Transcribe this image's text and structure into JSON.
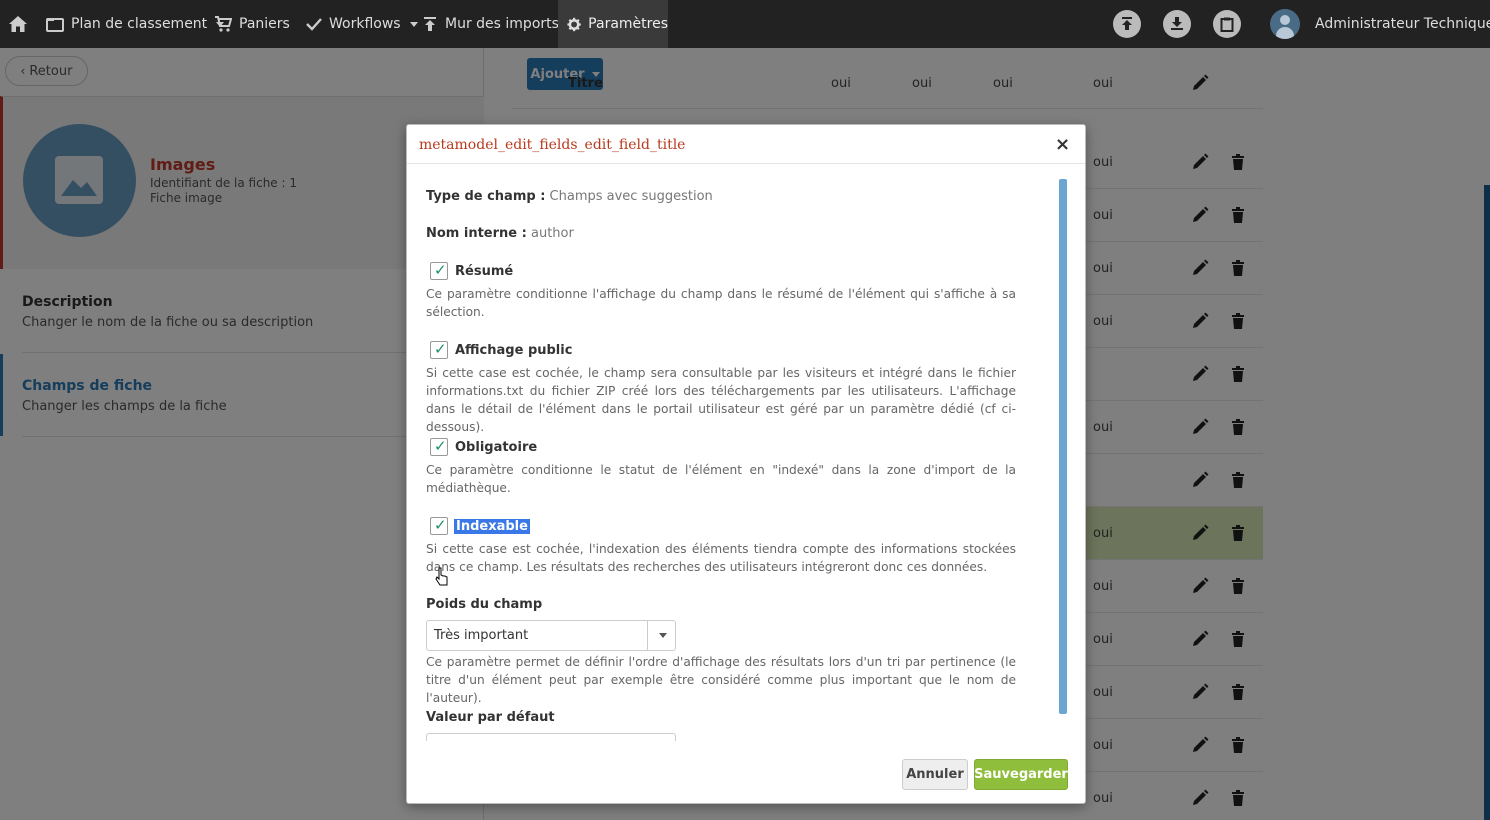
{
  "nav": {
    "home_icon": "home-icon",
    "items": [
      {
        "label": "Plan de classement",
        "icon": "folder-icon",
        "dropdown": true
      },
      {
        "label": "Paniers",
        "icon": "cart-icon",
        "dropdown": false
      },
      {
        "label": "Workflows",
        "icon": "check-icon",
        "dropdown": true
      },
      {
        "label": "Mur des imports",
        "icon": "upload-icon",
        "dropdown": false
      },
      {
        "label": "Paramètres",
        "icon": "gear-icon",
        "dropdown": false
      }
    ],
    "user": "Administrateur Technique"
  },
  "left": {
    "back_label": "Retour",
    "fiche": {
      "title": "Images",
      "identifier": "Identifiant de la fiche : 1",
      "type": "Fiche image"
    },
    "menu": [
      {
        "title": "Description",
        "subtitle": "Changer le nom de la fiche ou sa description"
      },
      {
        "title": "Champs de fiche",
        "subtitle": "Changer les champs de la fiche"
      }
    ]
  },
  "table": {
    "add_label": "Ajouter",
    "rows": [
      {
        "name": "Titre",
        "c1": "oui",
        "c2": "oui",
        "c3": "oui",
        "c4": "oui",
        "deletable": false
      },
      {
        "name": "",
        "c1": "",
        "c2": "",
        "c3": "",
        "c4": "oui",
        "deletable": true
      },
      {
        "name": "",
        "c1": "",
        "c2": "",
        "c3": "",
        "c4": "oui",
        "deletable": true
      },
      {
        "name": "",
        "c1": "",
        "c2": "",
        "c3": "",
        "c4": "oui",
        "deletable": true
      },
      {
        "name": "",
        "c1": "",
        "c2": "",
        "c3": "",
        "c4": "oui",
        "deletable": true
      },
      {
        "name": "",
        "c1": "",
        "c2": "",
        "c3": "",
        "c4": "",
        "deletable": true
      },
      {
        "name": "",
        "c1": "",
        "c2": "",
        "c3": "",
        "c4": "oui",
        "deletable": true
      },
      {
        "name": "",
        "c1": "",
        "c2": "",
        "c3": "",
        "c4": "",
        "deletable": true
      },
      {
        "name": "",
        "c1": "",
        "c2": "",
        "c3": "",
        "c4": "oui",
        "deletable": true
      },
      {
        "name": "",
        "c1": "",
        "c2": "",
        "c3": "",
        "c4": "oui",
        "deletable": true
      },
      {
        "name": "",
        "c1": "",
        "c2": "",
        "c3": "",
        "c4": "oui",
        "deletable": true
      },
      {
        "name": "",
        "c1": "",
        "c2": "",
        "c3": "",
        "c4": "oui",
        "deletable": true
      },
      {
        "name": "",
        "c1": "",
        "c2": "",
        "c3": "",
        "c4": "oui",
        "deletable": true
      },
      {
        "name": "",
        "c1": "",
        "c2": "",
        "c3": "",
        "c4": "oui",
        "deletable": true
      }
    ]
  },
  "modal": {
    "title": "metamodel_edit_fields_edit_field_title",
    "type_label": "Type de champ :",
    "type_value": "Champs avec suggestion",
    "internal_label": "Nom interne :",
    "internal_value": "author",
    "options": [
      {
        "label": "Résumé",
        "checked": true,
        "help": "Ce paramètre conditionne l'affichage du champ dans le résumé de l'élément qui s'affiche à sa sélection."
      },
      {
        "label": "Affichage public",
        "checked": true,
        "help": "Si cette case est cochée, le champ sera consultable par les visiteurs et intégré dans le fichier informations.txt du fichier ZIP créé lors des téléchargements par les utilisateurs. L'affichage dans le détail de l'élément dans le portail utilisateur est géré par un paramètre dédié (cf ci-dessous)."
      },
      {
        "label": "Obligatoire",
        "checked": true,
        "help": "Ce paramètre conditionne le statut de l'élément en \"indexé\" dans la zone d'import de la médiathèque."
      },
      {
        "label": "Indexable",
        "checked": true,
        "help": "Si cette case est cochée, l'indexation des éléments tiendra compte des informations stockées dans ce champ. Les résultats des recherches des utilisateurs intégreront donc ces données."
      }
    ],
    "weight_label": "Poids du champ",
    "weight_value": "Très important",
    "weight_help": "Ce paramètre permet de définir l'ordre d'affichage des résultats lors d'un tri par pertinence (le titre d'un élément peut par exemple être considéré comme plus important que le nom de l'auteur).",
    "default_label": "Valeur par défaut",
    "cancel_label": "Annuler",
    "save_label": "Sauvegarder"
  }
}
